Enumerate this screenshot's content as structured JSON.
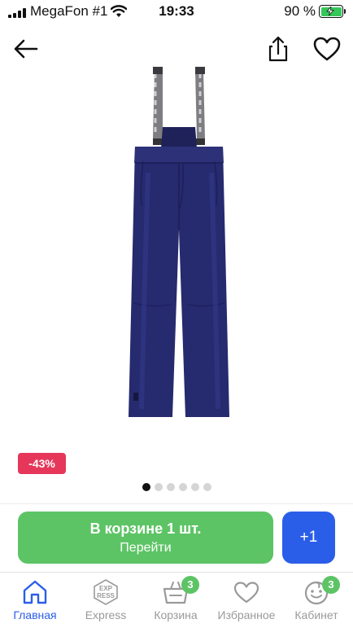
{
  "status_bar": {
    "carrier": "MegaFon #1",
    "time": "19:33",
    "battery": "90 %"
  },
  "header": {
    "back_icon": "arrow-left-icon",
    "share_icon": "share-icon",
    "favorite_icon": "heart-outline-icon"
  },
  "product": {
    "discount_badge": "-43%",
    "gallery": {
      "total_images": 6,
      "active_index": 0
    },
    "colors": {
      "pants": "#262a6e",
      "badge": "#e6375a"
    }
  },
  "actions": {
    "cart_button_title": "В корзине 1 шт.",
    "cart_button_subtitle": "Перейти",
    "increment_label": "+1",
    "colors": {
      "cart": "#5dc465",
      "increment": "#2b5ee8"
    }
  },
  "tabbar": {
    "tabs": [
      {
        "label": "Главная",
        "icon": "home-icon",
        "active": true
      },
      {
        "label": "Express",
        "icon": "express-icon",
        "active": false
      },
      {
        "label": "Корзина",
        "icon": "basket-icon",
        "badge": "3",
        "active": false
      },
      {
        "label": "Избранное",
        "icon": "heart-icon",
        "active": false
      },
      {
        "label": "Кабинет",
        "icon": "smile-icon",
        "badge": "3",
        "active": false
      }
    ],
    "express_icon_text": [
      "EXP",
      "RESS"
    ],
    "accent": "#2b5ee8"
  }
}
